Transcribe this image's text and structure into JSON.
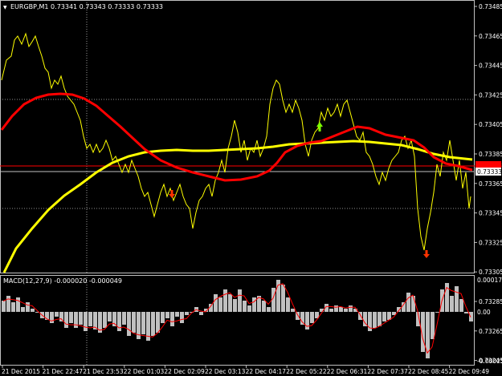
{
  "header": {
    "symbol_line": "EURGBP,M1  0.73341 0.73343 0.73333 0.73333",
    "dropdown_glyph": "▼"
  },
  "macd": {
    "label": "MACD(12,27,9) -0.000020 -0.000049",
    "axis": [
      "0.000179",
      "0.00",
      "-0.000253"
    ]
  },
  "price_axis": [
    "0.73485",
    "0.73465",
    "0.73445",
    "0.73425",
    "0.73405",
    "0.73385",
    "0.73365",
    "0.73345",
    "0.73325",
    "0.73305",
    "0.73285",
    "0.73265",
    "0.73245"
  ],
  "price_tags": {
    "red_level": "0.73338",
    "current": "0.73333"
  },
  "time_axis": [
    "21 Dec 2015",
    "21 Dec 22:47",
    "21 Dec 23:53",
    "22 Dec 01:03",
    "22 Dec 02:09",
    "22 Dec 03:13",
    "22 Dec 04:17",
    "22 Dec 05:22",
    "22 Dec 06:31",
    "22 Dec 07:37",
    "22 Dec 08:45",
    "22 Dec 09:49"
  ],
  "colors": {
    "background": "#000000",
    "price_line": "#ffff00",
    "fast_ma": "#ff0000",
    "slow_ma": "#ffff00",
    "grid": "#c0c0c0",
    "macd_hist": "#c0c0c0",
    "macd_signal": "#ff0000",
    "arrow_up": "#7cfc00",
    "arrow_down": "#ff3300"
  },
  "icons": {
    "buy_arrow": "arrow-up-icon",
    "sell_arrow": "arrow-down-icon"
  }
}
